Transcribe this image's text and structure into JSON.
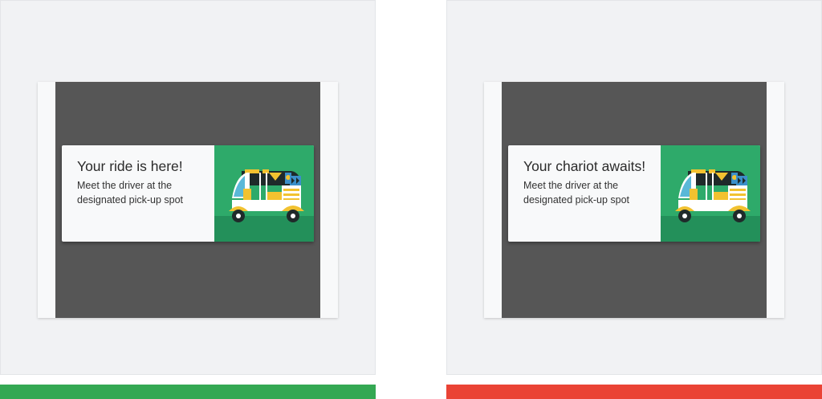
{
  "variants": [
    {
      "title": "Your ride is here!",
      "body_line1": "Meet the driver at the",
      "body_line2": "designated pick-up spot",
      "bar_color": "#34a853"
    },
    {
      "title": "Your chariot awaits!",
      "body_line1": "Meet the driver at the",
      "body_line2": "designated pick-up spot",
      "bar_color": "#ea4335"
    }
  ],
  "illustration": {
    "icon": "auto-rickshaw-icon",
    "background": "#2eaa6a",
    "ground": "#23905a"
  }
}
